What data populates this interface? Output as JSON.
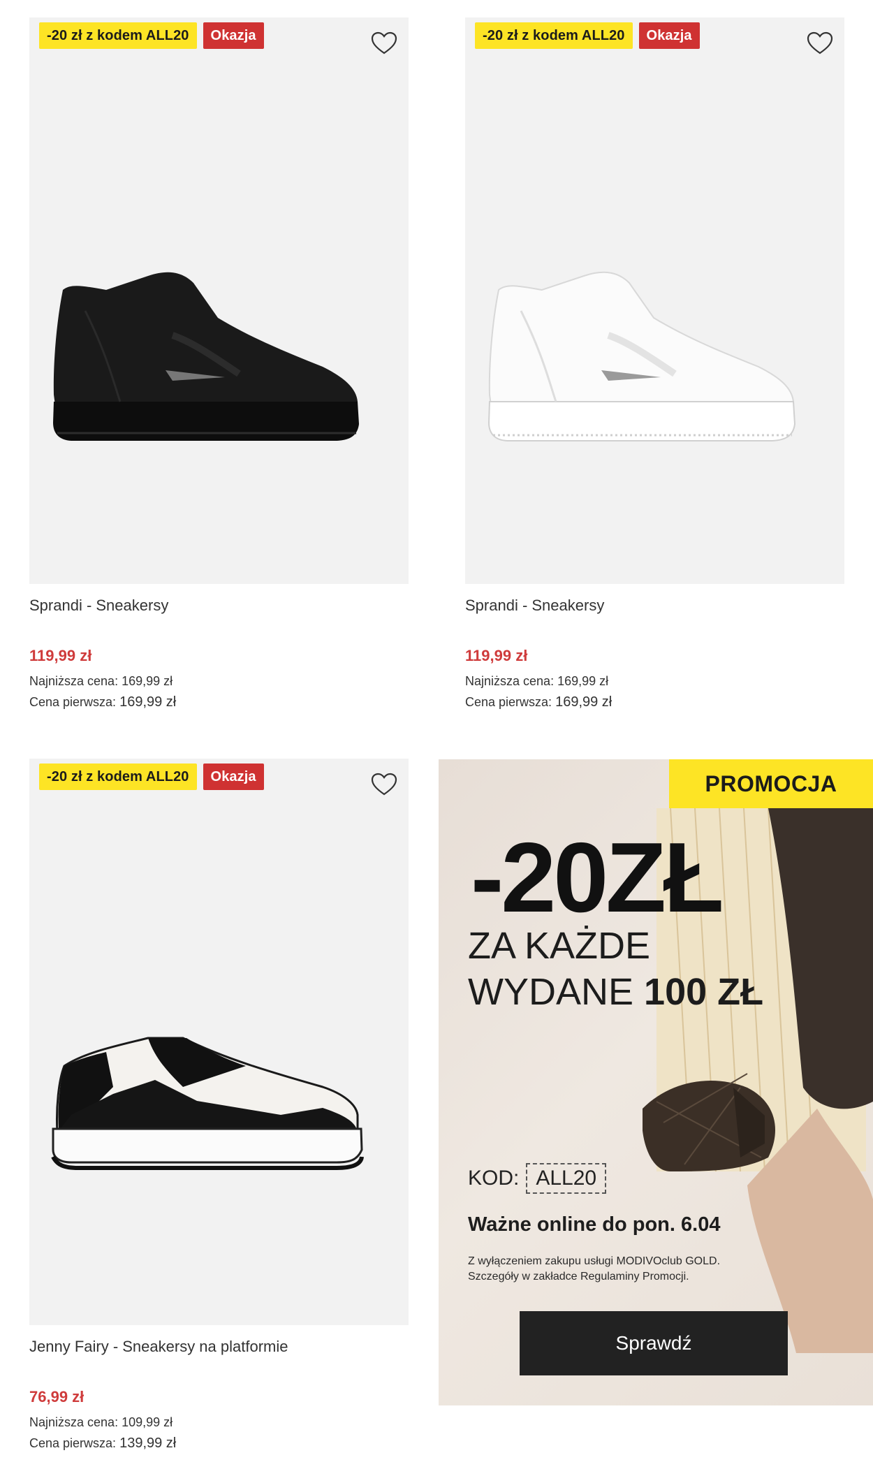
{
  "products": [
    {
      "badge_code": "-20 zł z kodem ALL20",
      "badge_deal": "Okazja",
      "name": "Sprandi - Sneakersy",
      "price": "119,99 zł",
      "lowest_label": "Najniższa cena:",
      "lowest_value": "169,99 zł",
      "original_label": "Cena pierwsza:",
      "original_value": "169,99 zł",
      "shoe_color": "black-hightop"
    },
    {
      "badge_code": "-20 zł z kodem ALL20",
      "badge_deal": "Okazja",
      "name": "Sprandi - Sneakersy",
      "price": "119,99 zł",
      "lowest_label": "Najniższa cena:",
      "lowest_value": "169,99 zł",
      "original_label": "Cena pierwsza:",
      "original_value": "169,99 zł",
      "shoe_color": "white-hightop"
    },
    {
      "badge_code": "-20 zł z kodem ALL20",
      "badge_deal": "Okazja",
      "name": "Jenny Fairy - Sneakersy na platformie",
      "price": "76,99 zł",
      "lowest_label": "Najniższa cena:",
      "lowest_value": "109,99 zł",
      "original_label": "Cena pierwsza:",
      "original_value": "139,99 zł",
      "shoe_color": "black-white-lowtop"
    }
  ],
  "promo": {
    "tag": "PROMOCJA",
    "amount": "-20ZŁ",
    "line1": "ZA KAŻDE",
    "line2_prefix": "WYDANE ",
    "line2_bold": "100 ZŁ",
    "code_label": "KOD:",
    "code": "ALL20",
    "valid": "Ważne online do pon. 6.04",
    "fine1": "Z wyłączeniem zakupu usługi MODIVOclub GOLD.",
    "fine2": "Szczegóły w zakładce Regulaminy Promocji.",
    "button": "Sprawdź"
  },
  "colors": {
    "badge_yellow": "#fde425",
    "badge_red": "#cf3232",
    "price_red": "#cf3b3b",
    "button_dark": "#222222"
  },
  "icons": [
    "heart-icon"
  ]
}
